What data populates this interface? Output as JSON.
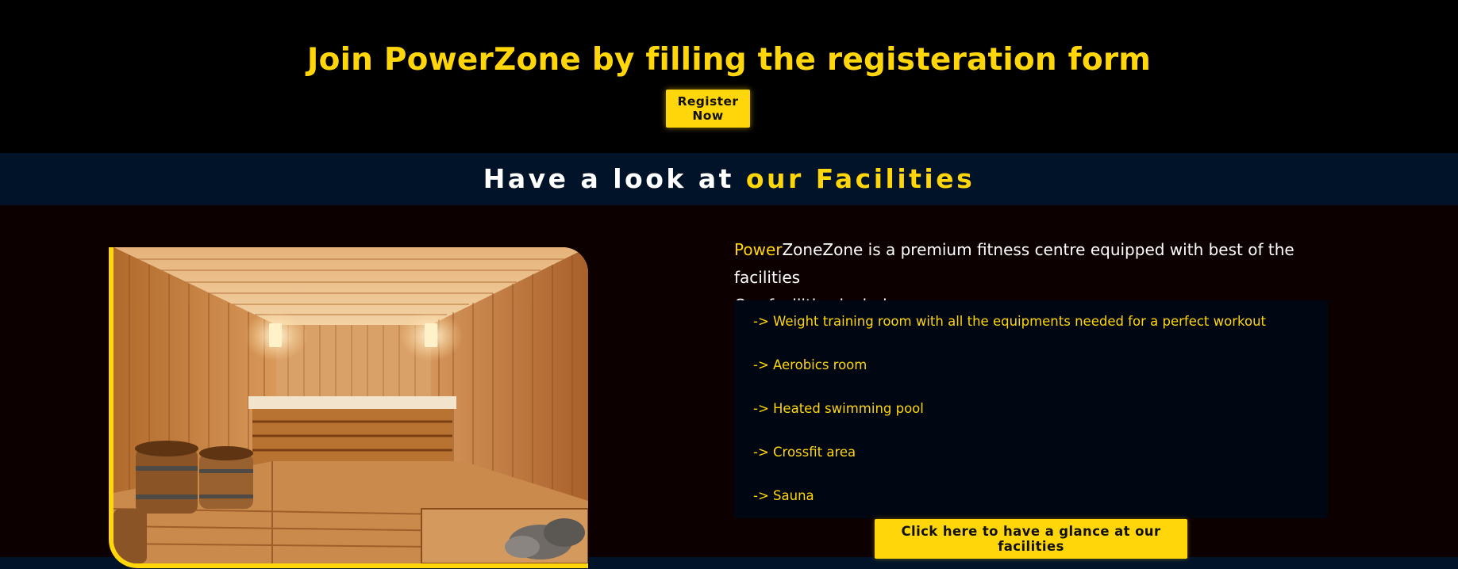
{
  "registration": {
    "title": "Join PowerZone by filling the registeration form",
    "button_label": "Register Now"
  },
  "facilities": {
    "heading_prefix": "Have a look at ",
    "heading_accent": "our Facilities",
    "intro_brand_accent": "Power",
    "intro_rest": "ZoneZone is a premium fitness centre equipped with best of the facilities",
    "intro_line2": "Our facilities include :-",
    "items": [
      "-> Weight training room with all the equipments needed for a perfect workout",
      "-> Aerobics room",
      "-> Heated swimming pool",
      "-> Crossfit area",
      "-> Sauna"
    ],
    "glance_button_label": "Click here to have a glance at our facilities",
    "image_alt": "sauna-room-photo"
  },
  "colors": {
    "accent": "#FFD60A",
    "background": "#000000",
    "band": "#001329",
    "content_bg": "#0d0000",
    "list_bg": "#000612"
  }
}
